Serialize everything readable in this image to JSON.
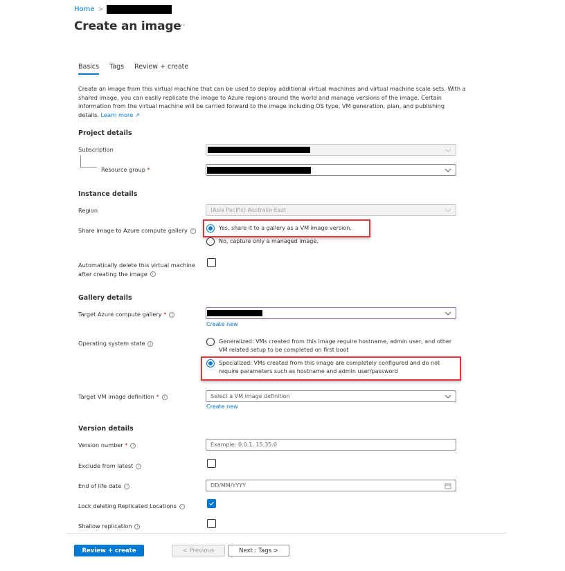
{
  "breadcrumb": {
    "home": "Home",
    "separator": ">"
  },
  "page": {
    "title": "Create an image",
    "more": "···"
  },
  "tabs": [
    {
      "label": "Basics",
      "active": true
    },
    {
      "label": "Tags",
      "active": false
    },
    {
      "label": "Review + create",
      "active": false
    }
  ],
  "description": {
    "text": "Create an image from this virtual machine that can be used to deploy additional virtual machines and virtual machine scale sets. With a shared image, you can easily replicate the image to Azure regions around the world and manage versions of the image. Certain information from the virtual machine will be carried forward to the image including OS type, VM generation, plan, and publishing details.",
    "learn_more": "Learn more",
    "external_icon": "↗"
  },
  "project": {
    "heading": "Project details",
    "subscription_label": "Subscription",
    "resource_group_label": "Resource group",
    "required": "*"
  },
  "instance": {
    "heading": "Instance details",
    "region_label": "Region",
    "region_value": "(Asia Pacific) Australia East",
    "share_label": "Share image to Azure compute gallery",
    "share_yes": "Yes, share it to a gallery as a VM image version.",
    "share_no": "No, capture only a managed image.",
    "share_selected": "yes",
    "auto_delete_label_1": "Automatically delete this virtual machine",
    "auto_delete_label_2": "after creating the image",
    "auto_delete_checked": false
  },
  "gallery": {
    "heading": "Gallery details",
    "target_gallery_label": "Target Azure compute gallery",
    "create_new": "Create new",
    "os_state_label": "Operating system state",
    "generalized": "Generalized: VMs created from this image require hostname, admin user, and other VM related setup to be completed on first boot",
    "specialized": "Specialized: VMs created from this image are completely configured and do not require parameters such as hostname and admin user/password",
    "os_state_selected": "specialized",
    "target_def_label": "Target VM image definition",
    "target_def_placeholder": "Select a VM image definition",
    "create_new_2": "Create new"
  },
  "version": {
    "heading": "Version details",
    "number_label": "Version number",
    "number_placeholder": "Example: 0.0.1, 15.35.0",
    "exclude_label": "Exclude from latest",
    "exclude_checked": false,
    "eol_label": "End of life date",
    "eol_placeholder": "DD/MM/YYYY",
    "lock_label": "Lock deleting Replicated Locations",
    "lock_checked": true,
    "shallow_label": "Shallow replication",
    "shallow_checked": false
  },
  "footer": {
    "review_create": "Review + create",
    "previous": "< Previous",
    "next": "Next : Tags >"
  },
  "colors": {
    "accent": "#0078d4",
    "highlight": "#e3353b",
    "required": "#a4262c"
  }
}
